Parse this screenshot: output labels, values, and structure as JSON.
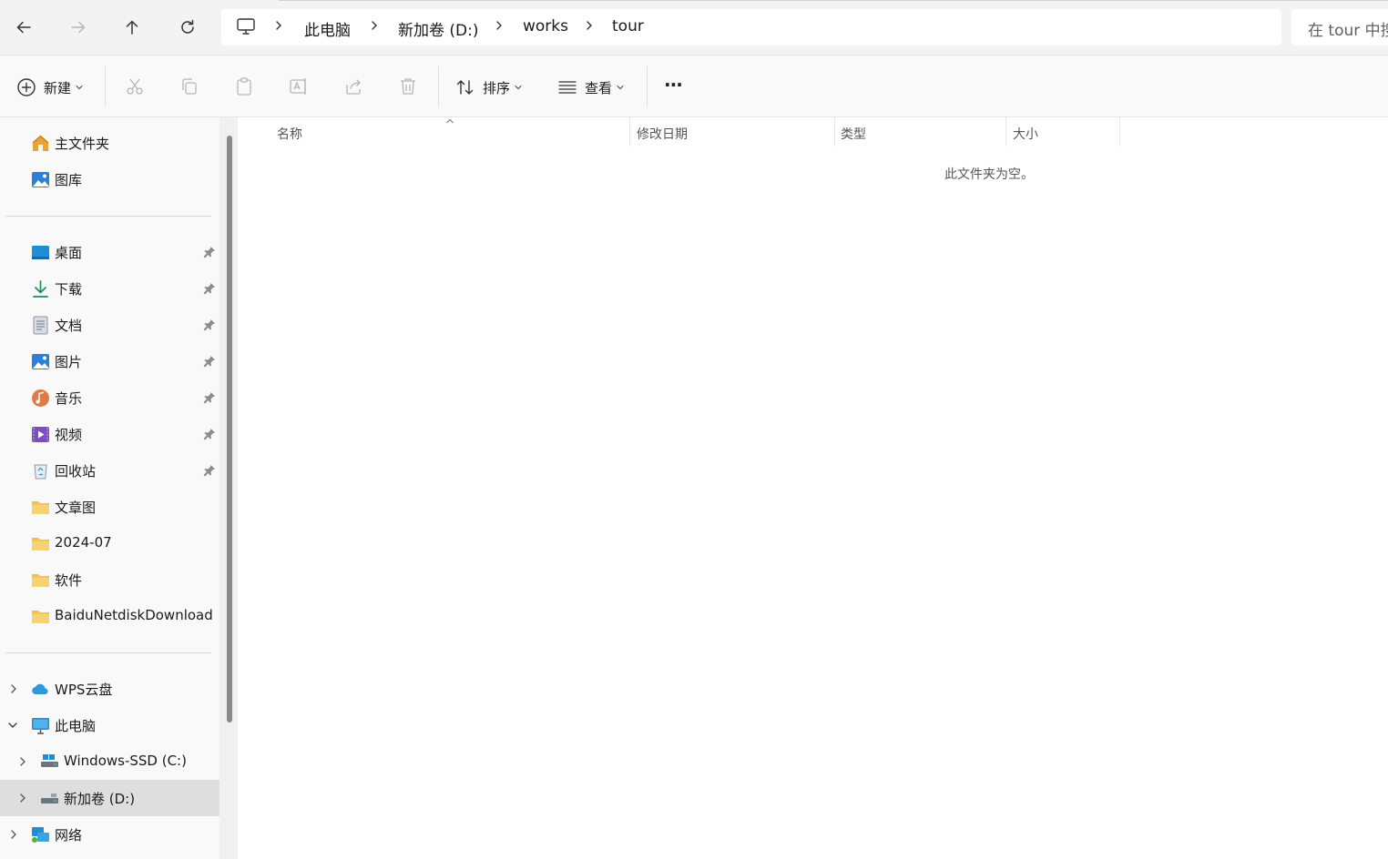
{
  "address": {
    "crumbs": [
      "此电脑",
      "新加卷 (D:)",
      "works",
      "tour"
    ],
    "search_placeholder": "在 tour 中搜"
  },
  "toolbar": {
    "new_label": "新建",
    "sort_label": "排序",
    "view_label": "查看",
    "more_label": "···"
  },
  "sidebar": {
    "home": "主文件夹",
    "gallery": "图库",
    "desktop": "桌面",
    "downloads": "下载",
    "documents": "文档",
    "pictures": "图片",
    "music": "音乐",
    "videos": "视频",
    "recycle": "回收站",
    "folder1": "文章图",
    "folder2": "2024-07",
    "folder3": "软件",
    "folder4": "BaiduNetdiskDownload",
    "wps": "WPS云盘",
    "thispc": "此电脑",
    "drive_c": "Windows-SSD (C:)",
    "drive_d": "新加卷 (D:)",
    "network": "网络"
  },
  "columns": {
    "name": "名称",
    "modified": "修改日期",
    "type": "类型",
    "size": "大小"
  },
  "empty_text": "此文件夹为空。",
  "colors": {
    "accent": "#0067c0",
    "folder": "#f2c04d",
    "selected": "#dedede"
  }
}
